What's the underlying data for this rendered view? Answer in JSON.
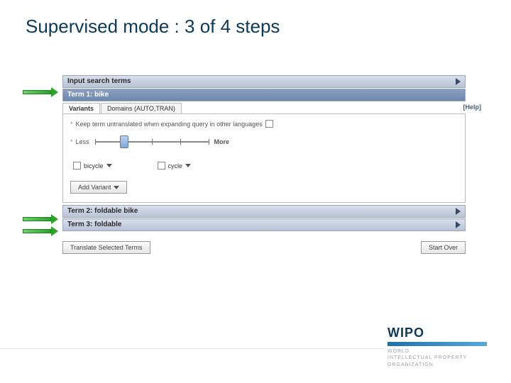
{
  "title": "Supervised mode : 3 of 4 steps",
  "header_bar": {
    "label": "Input search terms"
  },
  "term1": {
    "label": "Term 1: bike"
  },
  "tabs": {
    "variants": "Variants",
    "domains": "Domains (AUTO,TRAN)"
  },
  "help": "[Help]",
  "keep_row": {
    "star": "*",
    "label": "Keep term untranslated when expanding query in other languages"
  },
  "slider": {
    "star": "*",
    "less": "Less",
    "more": "More"
  },
  "variant_options": {
    "bicycle": "bicycle",
    "cycle": "cycle"
  },
  "add_variant": "Add Variant",
  "term2": {
    "label": "Term 2: foldable bike"
  },
  "term3": {
    "label": "Term 3: foldable"
  },
  "footer": {
    "translate": "Translate Selected Terms",
    "start_over": "Start Over"
  },
  "wipo": {
    "name": "WIPO",
    "l1": "WORLD",
    "l2": "INTELLECTUAL PROPERTY",
    "l3": "ORGANIZATION"
  }
}
